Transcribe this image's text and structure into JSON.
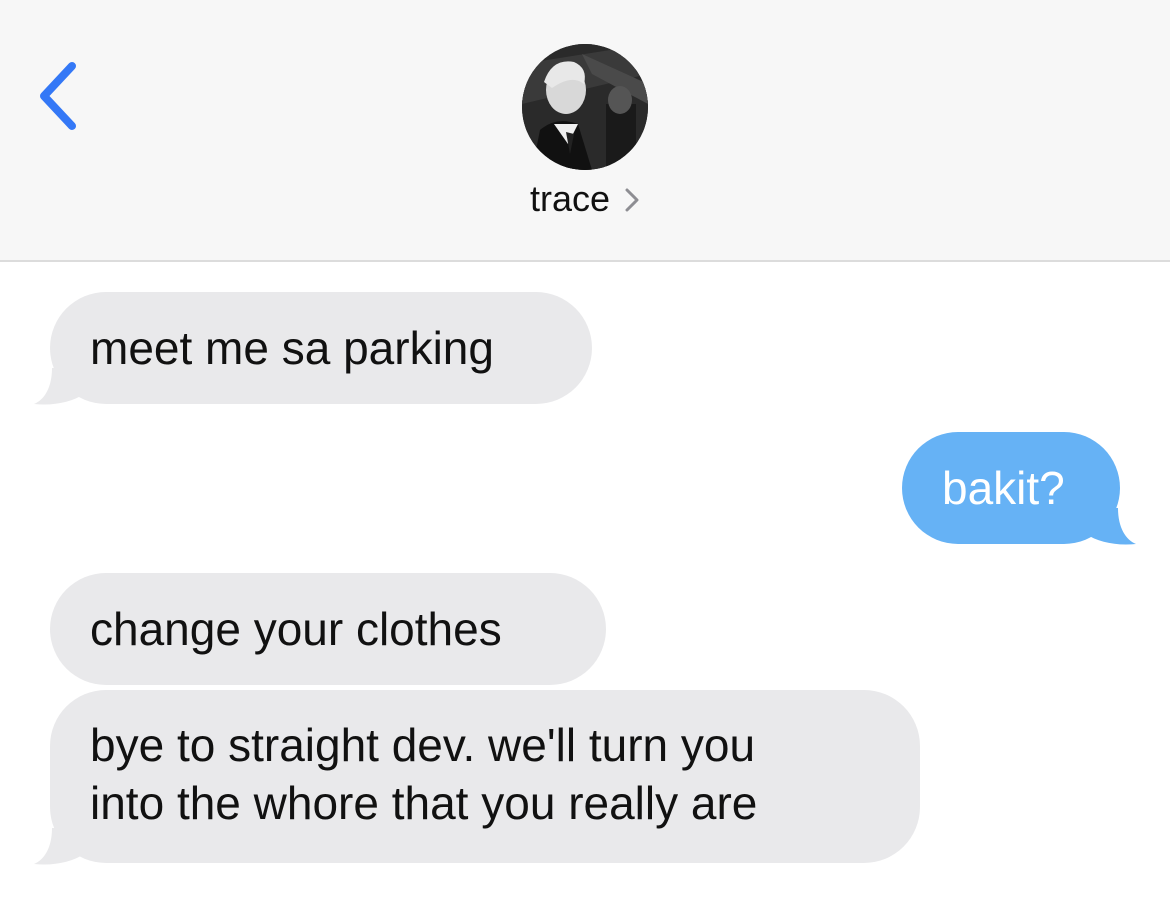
{
  "header": {
    "contact_name": "trace"
  },
  "messages": [
    {
      "direction": "incoming",
      "lines": [
        "meet me sa parking"
      ]
    },
    {
      "direction": "outgoing",
      "lines": [
        "bakit?"
      ]
    },
    {
      "direction": "incoming",
      "lines": [
        "change your clothes"
      ]
    },
    {
      "direction": "incoming",
      "lines": [
        "bye to straight dev. we'll turn you",
        "into the whore that you really are"
      ]
    }
  ],
  "colors": {
    "accent": "#3478f6",
    "incoming_bubble": "#e9e9eb",
    "outgoing_bubble": "#66b2f5",
    "header_bg": "#f7f7f7"
  }
}
